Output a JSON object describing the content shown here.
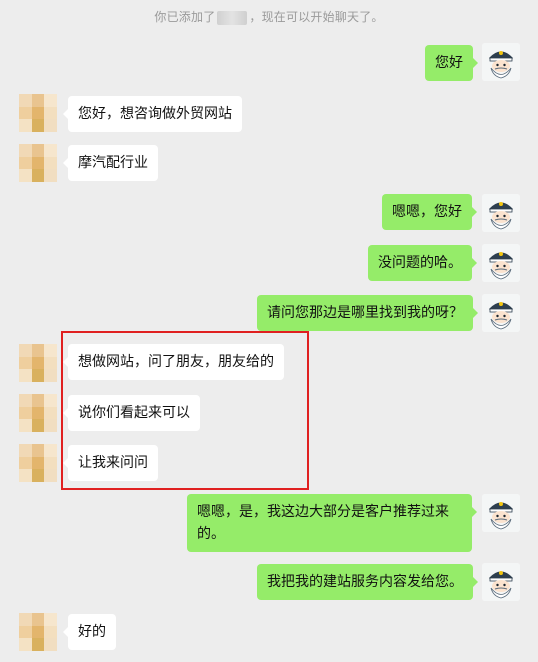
{
  "system_notice": {
    "prefix": "你已添加了",
    "suffix": "，现在可以开始聊天了。"
  },
  "colors": {
    "background": "#ededed",
    "sent_bubble": "#95ec69",
    "received_bubble": "#ffffff",
    "highlight_border": "#e02020"
  },
  "messages": [
    {
      "side": "right",
      "text": "您好"
    },
    {
      "side": "left",
      "text": "您好，想咨询做外贸网站"
    },
    {
      "side": "left",
      "text": "摩汽配行业"
    },
    {
      "side": "right",
      "text": "嗯嗯，您好"
    },
    {
      "side": "right",
      "text": "没问题的哈。"
    },
    {
      "side": "right",
      "text": "请问您那边是哪里找到我的呀？"
    },
    {
      "side": "left",
      "text": "想做网站，问了朋友，朋友给的"
    },
    {
      "side": "left",
      "text": "说你们看起来可以"
    },
    {
      "side": "left",
      "text": "让我来问问"
    },
    {
      "side": "right",
      "text": "嗯嗯，是，我这边大部分是客户推荐过来的。"
    },
    {
      "side": "right",
      "text": "我把我的建站服务内容发给您。"
    },
    {
      "side": "left",
      "text": "好的"
    }
  ],
  "avatars": {
    "contact": "blurred-avatar",
    "self": "captain-cartoon-avatar"
  }
}
